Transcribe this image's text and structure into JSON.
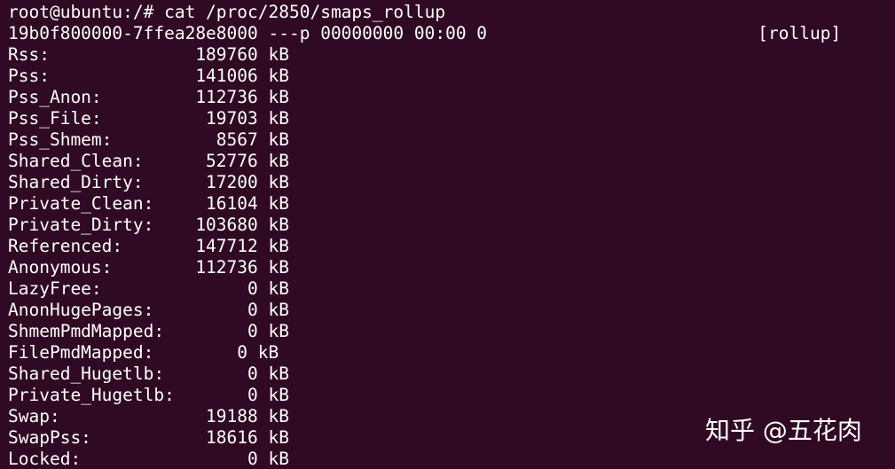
{
  "terminal": {
    "lines": [
      "root@ubuntu:/# cat /proc/2850/smaps_rollup",
      "19b0f800000-7ffea28e8000 ---p 00000000 00:00 0                          [rollup]",
      "Rss:              189760 kB",
      "Pss:              141006 kB",
      "Pss_Anon:         112736 kB",
      "Pss_File:          19703 kB",
      "Pss_Shmem:          8567 kB",
      "Shared_Clean:      52776 kB",
      "Shared_Dirty:      17200 kB",
      "Private_Clean:     16104 kB",
      "Private_Dirty:    103680 kB",
      "Referenced:       147712 kB",
      "Anonymous:        112736 kB",
      "LazyFree:              0 kB",
      "AnonHugePages:         0 kB",
      "ShmemPmdMapped:        0 kB",
      "FilePmdMapped:        0 kB",
      "Shared_Hugetlb:        0 kB",
      "Private_Hugetlb:       0 kB",
      "Swap:              19188 kB",
      "SwapPss:           18616 kB",
      "Locked:                0 kB"
    ]
  },
  "watermark": {
    "text": "知乎 @五花肉"
  }
}
